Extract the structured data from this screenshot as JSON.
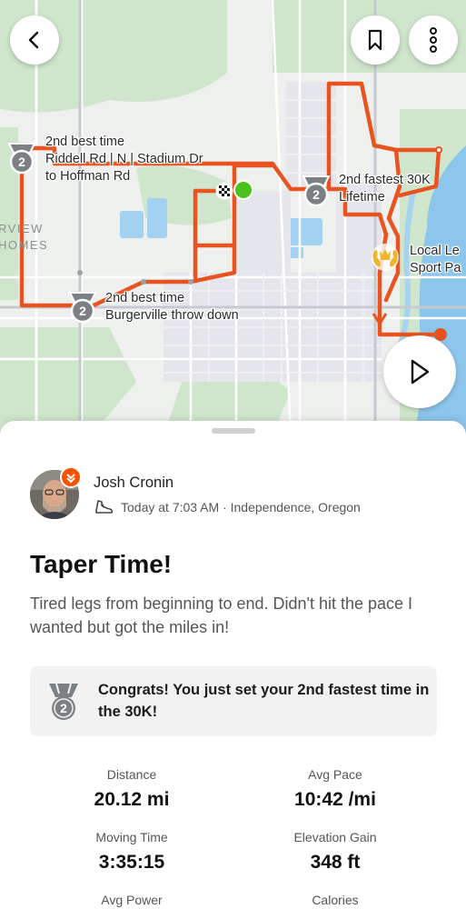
{
  "map": {
    "labels": {
      "segment1": [
        "2nd best time",
        "Riddell Rd | N | Stadium Dr",
        "to Hoffman Rd"
      ],
      "segment2": [
        "2nd fastest 30K",
        "Lifetime"
      ],
      "segment3": [
        "2nd best time",
        "Burgerville throw down"
      ],
      "local_legend": [
        "Local Le",
        "Sport Pa"
      ],
      "area": [
        "RVIEW",
        "HOMES"
      ]
    },
    "medal_rank": "2",
    "route_color": "#e8531f"
  },
  "buttons": {
    "back": "chevron-left-icon",
    "save": "bookmark-icon",
    "more": "more-vertical-icon",
    "play": "play-icon"
  },
  "activity": {
    "athlete": "Josh Cronin",
    "meta": "Today at 7:03 AM · Independence, Oregon",
    "sport_icon": "shoe-icon",
    "title": "Taper Time!",
    "description": "Tired legs from beginning to end. Didn't hit the pace I wanted but got the miles in!",
    "achievement": "Congrats! You just set your 2nd fastest time in the 30K!",
    "achievement_rank": "2"
  },
  "stats": [
    {
      "label": "Distance",
      "value": "20.12 mi"
    },
    {
      "label": "Avg Pace",
      "value": "10:42 /mi"
    },
    {
      "label": "Moving Time",
      "value": "3:35:15"
    },
    {
      "label": "Elevation Gain",
      "value": "348 ft"
    },
    {
      "label": "Avg Power",
      "value": ""
    },
    {
      "label": "Calories",
      "value": ""
    }
  ]
}
